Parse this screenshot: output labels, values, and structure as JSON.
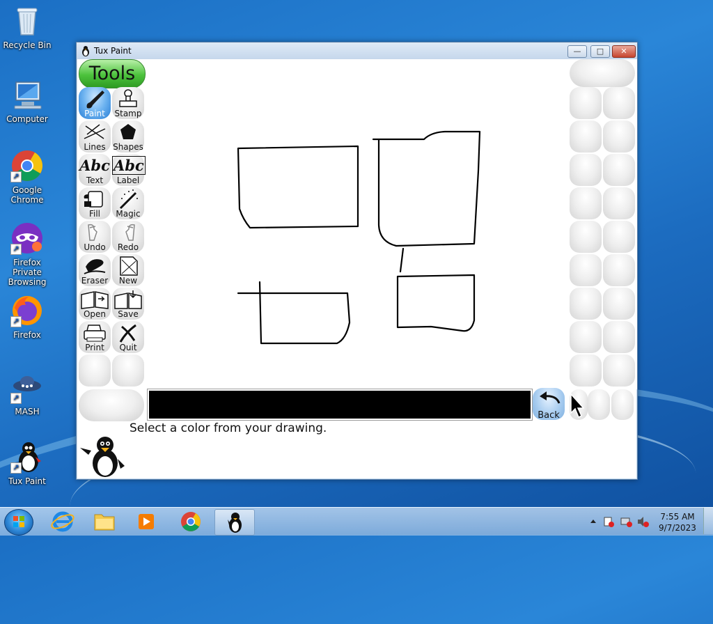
{
  "desktop": {
    "icons": [
      {
        "label": "Recycle Bin"
      },
      {
        "label": "Computer"
      },
      {
        "label": "Google Chrome"
      },
      {
        "label": "Firefox Private Browsing"
      },
      {
        "label": "Firefox"
      },
      {
        "label": "MASH"
      },
      {
        "label": "Tux Paint"
      }
    ]
  },
  "window": {
    "title": "Tux Paint",
    "controls": {
      "minimize": "—",
      "maximize": "□",
      "close": "✕"
    }
  },
  "tools": {
    "header": "Tools",
    "items": [
      {
        "label": "Paint",
        "icon": "paintbrush-icon",
        "active": true
      },
      {
        "label": "Stamp",
        "icon": "stamp-icon"
      },
      {
        "label": "Lines",
        "icon": "lines-icon"
      },
      {
        "label": "Shapes",
        "icon": "pentagon-icon"
      },
      {
        "label": "Text",
        "icon": "text-abc-icon",
        "glyph": "Abc"
      },
      {
        "label": "Label",
        "icon": "label-abc-icon",
        "glyph": "Abc"
      },
      {
        "label": "Fill",
        "icon": "paint-bucket-icon"
      },
      {
        "label": "Magic",
        "icon": "magic-wand-icon"
      },
      {
        "label": "Undo",
        "icon": "undo-hand-icon"
      },
      {
        "label": "Redo",
        "icon": "redo-hand-icon"
      },
      {
        "label": "Eraser",
        "icon": "eraser-icon"
      },
      {
        "label": "New",
        "icon": "new-page-icon"
      },
      {
        "label": "Open",
        "icon": "open-book-icon"
      },
      {
        "label": "Save",
        "icon": "save-book-icon"
      },
      {
        "label": "Print",
        "icon": "printer-icon"
      },
      {
        "label": "Quit",
        "icon": "quit-x-icon"
      }
    ]
  },
  "bottom": {
    "back_label": "Back",
    "status_text": "Select a color from your drawing.",
    "selected_color": "#000000"
  },
  "taskbar": {
    "time": "7:55 AM",
    "date": "9/7/2023",
    "apps": [
      "internet-explorer",
      "file-explorer",
      "media-player",
      "google-chrome",
      "tux-paint"
    ]
  }
}
